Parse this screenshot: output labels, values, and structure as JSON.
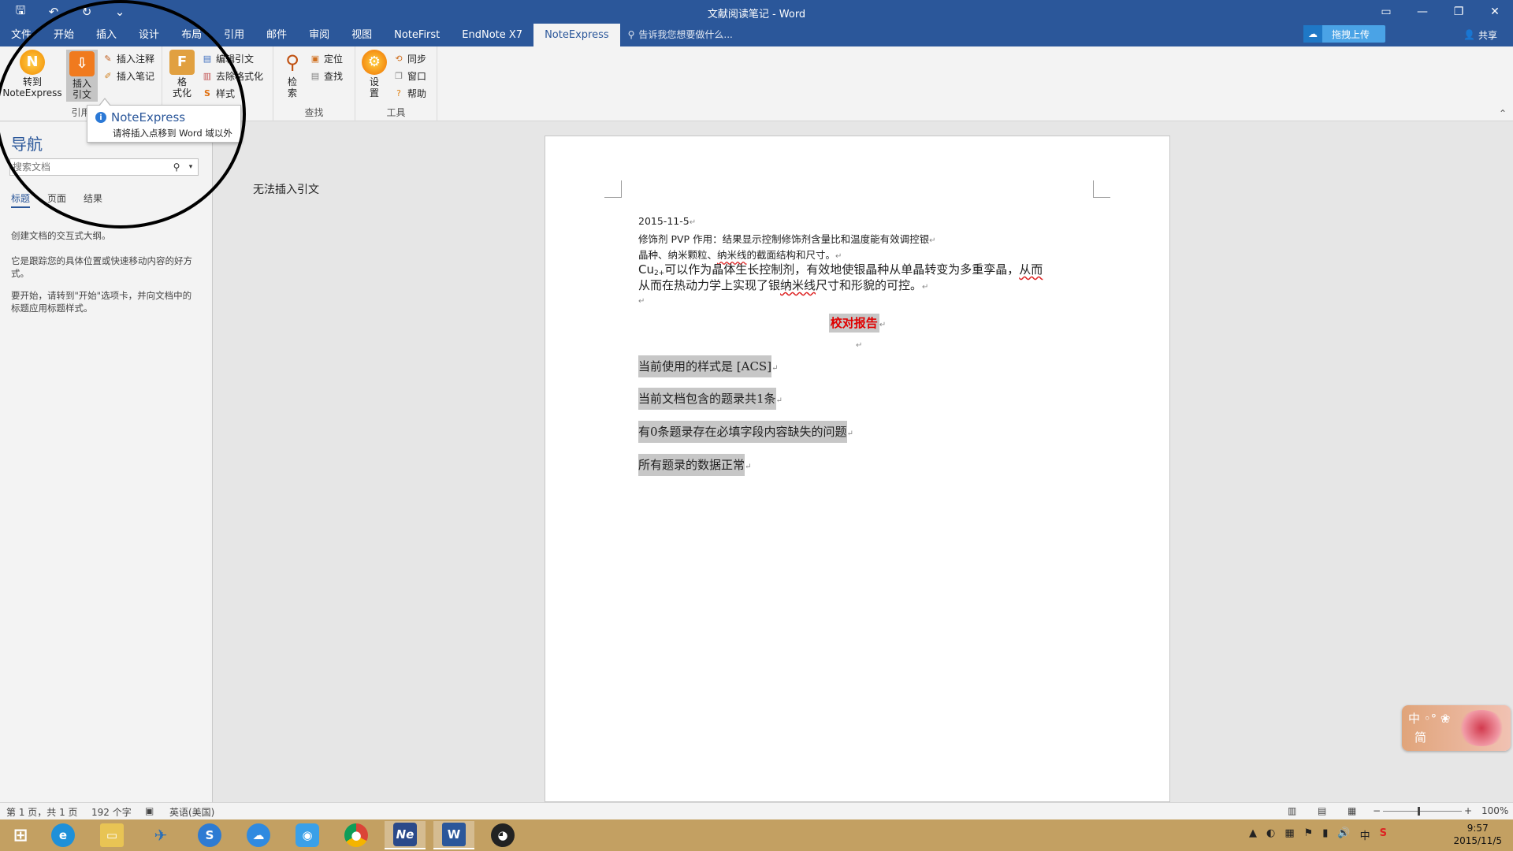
{
  "window": {
    "title": "文献阅读笔记 - Word",
    "qat": {
      "save": "🖫",
      "undo": "↶",
      "redo": "↻",
      "customize": "⌄"
    },
    "controls": {
      "ribbon_options": "▭",
      "minimize": "—",
      "maximize": "❐",
      "close": "✕"
    }
  },
  "tabs": [
    "文件",
    "开始",
    "插入",
    "设计",
    "布局",
    "引用",
    "邮件",
    "审阅",
    "视图",
    "NoteFirst",
    "EndNote X7",
    "NoteExpress"
  ],
  "active_tab": "NoteExpress",
  "tell_me": "告诉我您想要做什么...",
  "cloud_upload": "拖拽上传",
  "share": "共享",
  "ribbon": {
    "group_cite": {
      "label": "引用",
      "goto": {
        "line1": "转到",
        "line2": "NoteExpress"
      },
      "insert_citation": {
        "line1": "插入",
        "line2": "引文"
      },
      "insert_note": "插入注释",
      "insert_notebook": "插入笔记"
    },
    "group_format": {
      "format": {
        "line1": "格",
        "line2": "式化"
      },
      "edit_citation": "编辑引文",
      "remove_format": "去除格式化",
      "style": "样式"
    },
    "group_find": {
      "label": "查找",
      "search": {
        "line1": "检",
        "line2": "索"
      },
      "locate": "定位",
      "find": "查找"
    },
    "group_tools": {
      "label": "工具",
      "settings": {
        "line1": "设",
        "line2": "置"
      },
      "sync": "同步",
      "window": "窗口",
      "help": "帮助"
    }
  },
  "tooltip": {
    "title": "NoteExpress",
    "body": "请将插入点移到 Word 域以外"
  },
  "nav": {
    "title": "导航",
    "search_placeholder": "搜索文档",
    "tabs": [
      "标题",
      "页面",
      "结果"
    ],
    "text1": "创建文档的交互式大纲。",
    "text2": "它是跟踪您的具体位置或快速移动内容的好方式。",
    "text3": "要开始，请转到\"开始\"选项卡，并向文档中的标题应用标题样式。"
  },
  "doc_message": "无法插入引文",
  "document": {
    "date": "2015-11-5",
    "line2": "修饰剂 PVP 作用：结果显示控制修饰剂含量比和温度能有效调控银",
    "line3a": "晶种、纳米颗粒、",
    "line3b": "纳米线",
    "line3c": "的截面结构和尺寸。",
    "line4a": "Cu",
    "line4sub": "2+",
    "line4b": "可以作为晶体生长控制剂，有效地使银晶种从单晶转变为多重孪晶，",
    "line4c": "从而",
    "line5a": "从而在热动力学上实现了银",
    "line5b": "纳米线",
    "line5c": "尺寸和形貌的可控。",
    "report_title": "校对报告",
    "r1": "当前使用的样式是 [ACS]",
    "r2": "当前文档包含的题录共1条",
    "r3": "有0条题录存在必填字段内容缺失的问题",
    "r4": "所有题录的数据正常"
  },
  "ime": {
    "line1": "中 ◦° ❀",
    "line2": "简"
  },
  "status": {
    "page": "第 1 页，共 1 页",
    "words": "192 个字",
    "lang": "英语(美国)",
    "zoom": "100%"
  },
  "taskbar": {
    "tray_icons": [
      "▲",
      "◐",
      "▦",
      "⚑",
      "▮",
      "🔊",
      "中",
      "S"
    ],
    "time": "9:57",
    "date": "2015/11/5"
  },
  "colors": {
    "word_blue": "#2b579a",
    "taskbar": "#c3a062",
    "highlight": "#c7c7c7",
    "report_red": "#e00000"
  }
}
